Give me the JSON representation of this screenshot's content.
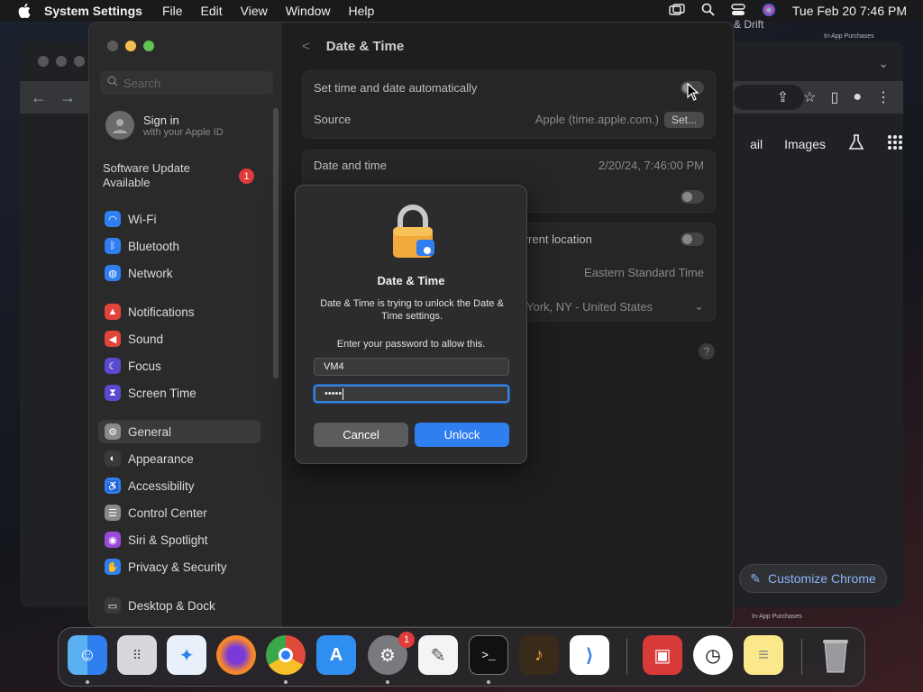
{
  "menubar": {
    "app_name": "System Settings",
    "menus": [
      "File",
      "Edit",
      "View",
      "Window",
      "Help"
    ],
    "clock": "Tue Feb 20  7:46 PM"
  },
  "chrome": {
    "hint_top": "& Drift",
    "hint_purchases_top": "In-App Purchases",
    "hint_purchases_bottom": "In-App Purchases",
    "link_mail": "ail",
    "link_images": "Images",
    "customize_label": "Customize Chrome"
  },
  "sidebar": {
    "search_placeholder": "Search",
    "signin_title": "Sign in",
    "signin_sub": "with your Apple ID",
    "update_label": "Software Update Available",
    "update_badge": "1",
    "items": [
      {
        "label": "Wi-Fi",
        "color": "#2f7ff0"
      },
      {
        "label": "Bluetooth",
        "color": "#2f7ff0"
      },
      {
        "label": "Network",
        "color": "#2f7ff0"
      },
      {
        "label": "Notifications",
        "color": "#e0443a"
      },
      {
        "label": "Sound",
        "color": "#e0443a"
      },
      {
        "label": "Focus",
        "color": "#5a4ad0"
      },
      {
        "label": "Screen Time",
        "color": "#5a4ad0"
      },
      {
        "label": "General",
        "color": "#8a8a8a"
      },
      {
        "label": "Appearance",
        "color": "#3a3a3a"
      },
      {
        "label": "Accessibility",
        "color": "#2f7ff0"
      },
      {
        "label": "Control Center",
        "color": "#8a8a8a"
      },
      {
        "label": "Siri & Spotlight",
        "color": "#9b4ad8"
      },
      {
        "label": "Privacy & Security",
        "color": "#2f7ff0"
      },
      {
        "label": "Desktop & Dock",
        "color": "#3a3a3a"
      }
    ]
  },
  "pane": {
    "title": "Date & Time",
    "auto_label": "Set time and date automatically",
    "source_label": "Source",
    "source_value": "Apple (time.apple.com.)",
    "set_button": "Set...",
    "datetime_label": "Date and time",
    "datetime_value": "2/20/24, 7:46:00 PM",
    "location_label": "current location",
    "timezone_value": "Eastern Standard Time",
    "city_value": "York, NY - United States",
    "help": "?"
  },
  "dialog": {
    "title": "Date & Time",
    "message": "Date & Time is trying to unlock the Date & Time settings.",
    "prompt": "Enter your password to allow this.",
    "username": "VM4",
    "password_mask": "•••••",
    "cancel_label": "Cancel",
    "unlock_label": "Unlock"
  },
  "dock": {
    "apps": [
      "finder",
      "launchpad",
      "safari",
      "firefox",
      "chrome",
      "app-store",
      "system-settings",
      "textedit",
      "terminal",
      "garageband",
      "vscode",
      "photo-booth",
      "clock",
      "notes",
      "trash"
    ],
    "settings_badge": "1"
  }
}
